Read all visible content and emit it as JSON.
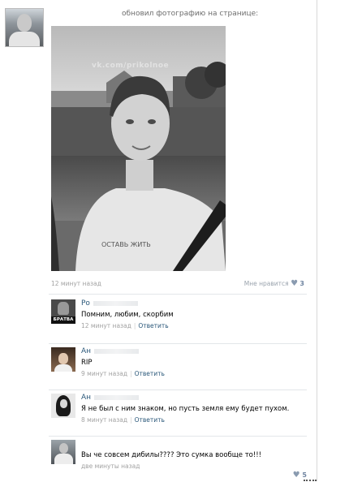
{
  "post": {
    "action": "обновил фотографию на странице:",
    "watermark": "vk.com/prikolnoe",
    "time": "12 минут назад",
    "like_label": "Мне нравится",
    "like_count": "3"
  },
  "comments": [
    {
      "name": "Ро",
      "text": "Помним, любим, скорбим",
      "time": "12 минут назад",
      "reply": "Ответить",
      "avatar_label": "БРАТВА"
    },
    {
      "name": "Ан",
      "text": "RIP",
      "time": "9 минут назад",
      "reply": "Ответить"
    },
    {
      "name": "Ан",
      "text": "Я не был с ним знаком, но пусть земля ему будет пухом.",
      "time": "8 минут назад",
      "reply": "Ответить"
    },
    {
      "name": "",
      "text": "Вы че совсем дибилы???? Это сумка вообще то!!!",
      "time": "две минуты назад",
      "like_count": "5"
    }
  ],
  "colors": {
    "link": "#2b587a",
    "meta": "#a2a2a2",
    "like": "#6f84a0"
  }
}
